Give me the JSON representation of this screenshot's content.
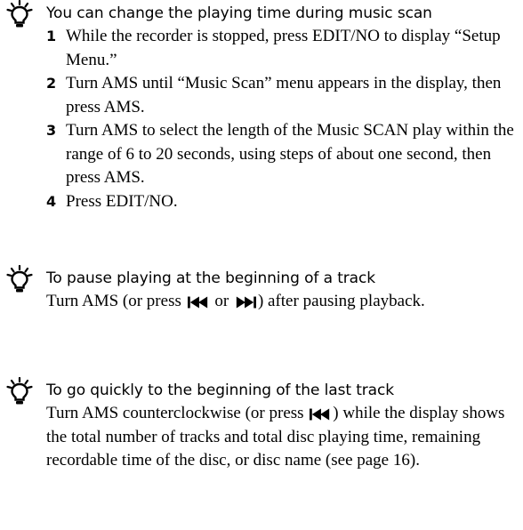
{
  "tips": [
    {
      "icon": "hint-lightbulb-icon",
      "heading": "You can change the playing time during music scan",
      "steps": [
        {
          "number": "1",
          "text": "While the recorder is stopped, press EDIT/NO to display “Setup Menu.”"
        },
        {
          "number": "2",
          "text": "Turn AMS until “Music Scan” menu appears in the display, then press AMS."
        },
        {
          "number": "3",
          "text": "Turn AMS to select the length of the Music SCAN play within the range of 6 to 20 seconds, using steps of about one second, then press AMS."
        },
        {
          "number": "4",
          "text": "Press EDIT/NO."
        }
      ]
    },
    {
      "icon": "hint-lightbulb-icon",
      "heading": "To pause playing at the beginning of a track",
      "body": {
        "part1": "Turn AMS (or press",
        "symbol1": "skip-back-icon",
        "part2": "or",
        "symbol2": "skip-forward-icon",
        "part3": ") after pausing playback."
      }
    },
    {
      "icon": "hint-lightbulb-icon",
      "heading": "To go quickly to the beginning of the last track",
      "body": {
        "part1": "Turn AMS counterclockwise (or press",
        "symbol1": "skip-back-icon",
        "part2": ") while the display shows the total number of tracks and total disc playing time, remaining recordable time of the disc, or disc name (see page 16)."
      }
    }
  ]
}
